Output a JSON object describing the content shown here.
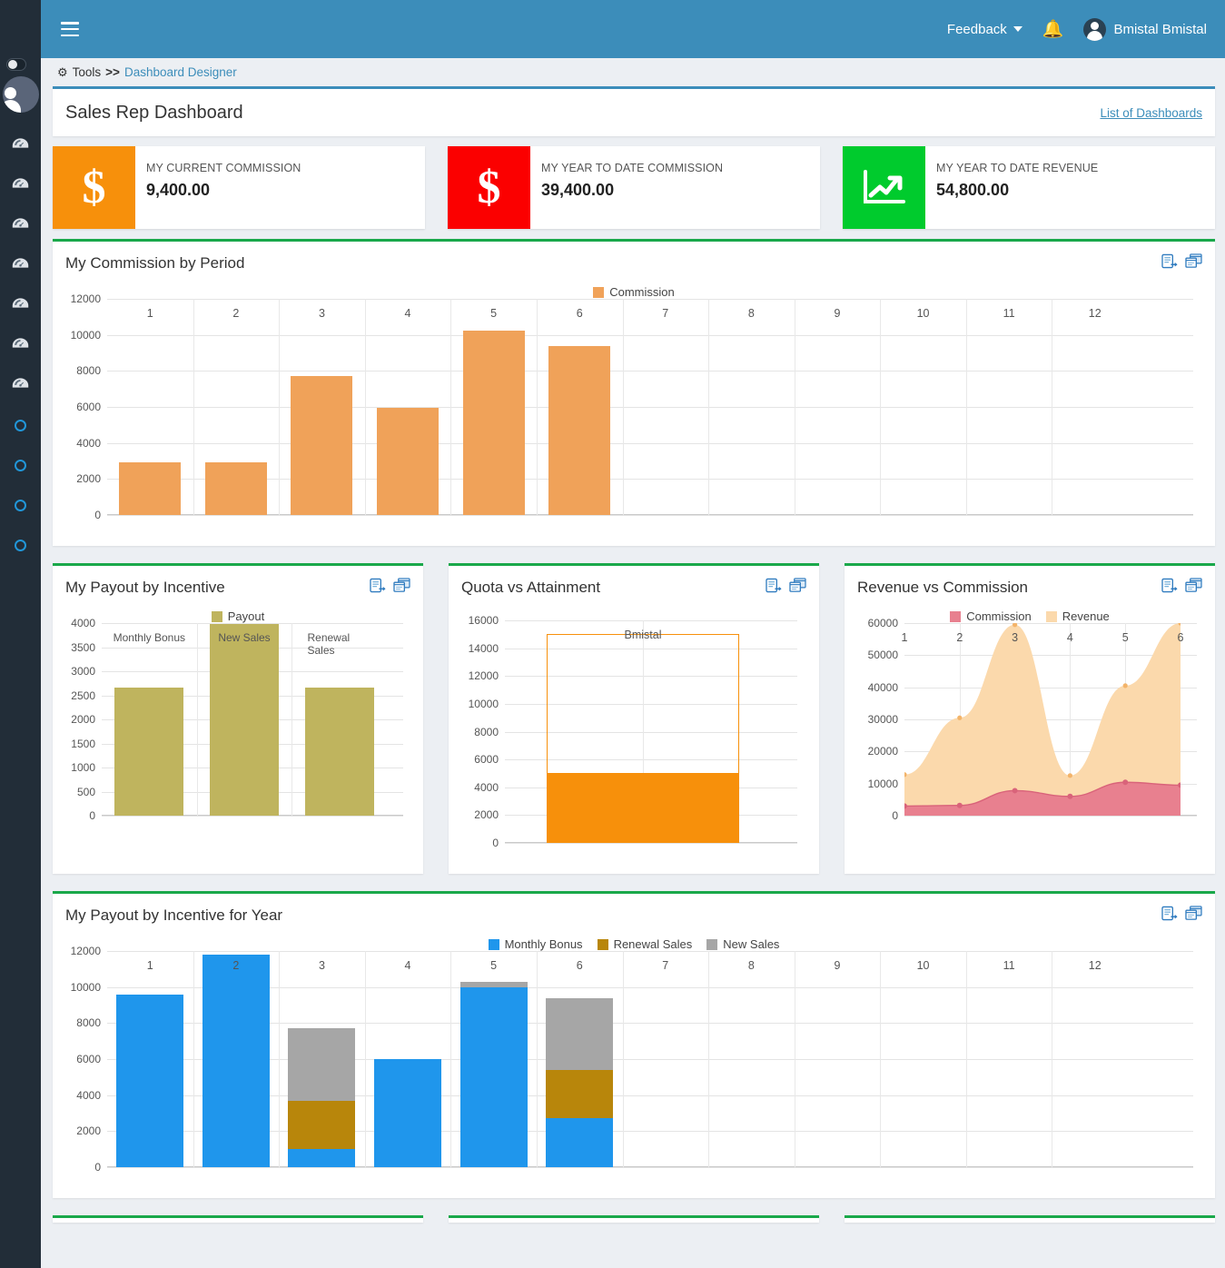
{
  "sidebar": {
    "toggle_name": "sidebar-collapse-toggle",
    "avatar_name": "sidebar-avatar",
    "items": [
      {
        "icon": "gauge-icon"
      },
      {
        "icon": "gauge-icon"
      },
      {
        "icon": "gauge-icon"
      },
      {
        "icon": "gauge-icon"
      },
      {
        "icon": "gauge-icon"
      },
      {
        "icon": "gauge-icon"
      },
      {
        "icon": "gauge-icon"
      },
      {
        "icon": "circle-icon"
      },
      {
        "icon": "circle-icon"
      },
      {
        "icon": "circle-icon"
      },
      {
        "icon": "circle-icon"
      }
    ]
  },
  "topbar": {
    "feedback_label": "Feedback",
    "bell_icon": "bell-icon",
    "user_name": "Bmistal Bmistal",
    "bg_color": "#3c8dba"
  },
  "breadcrumb": {
    "root": "Tools",
    "separator": ">>",
    "current": "Dashboard Designer"
  },
  "page": {
    "title": "Sales Rep Dashboard",
    "list_link": "List of Dashboards",
    "accent_green": "#19a84a",
    "accent_blue": "#3c8dba"
  },
  "kpis": [
    {
      "label": "MY CURRENT COMMISSION",
      "value": "9,400.00",
      "icon": "dollar-icon",
      "color": "#f7900b",
      "glyph": "$"
    },
    {
      "label": "MY YEAR TO DATE COMMISSION",
      "value": "39,400.00",
      "icon": "dollar-icon",
      "color": "#fb0000",
      "glyph": "$"
    },
    {
      "label": "MY YEAR TO DATE REVENUE",
      "value": "54,800.00",
      "icon": "trend-up-icon",
      "color": "#00cb2d",
      "glyph": ""
    }
  ],
  "panel_tools": {
    "export_icon": "export-report-icon",
    "popout_icon": "open-in-window-icon"
  },
  "panels": {
    "commission_by_period": "My Commission by Period",
    "payout_by_incentive": "My Payout by Incentive",
    "quota_vs_attainment": "Quota vs Attainment",
    "revenue_vs_commission": "Revenue vs Commission",
    "payout_by_incentive_year": "My Payout by Incentive for Year"
  },
  "chart_data": [
    {
      "id": "commission-by-period",
      "type": "bar",
      "title": "My Commission by Period",
      "xlabel": "",
      "ylabel": "",
      "categories": [
        "1",
        "2",
        "3",
        "4",
        "5",
        "6",
        "7",
        "8",
        "9",
        "10",
        "11",
        "12"
      ],
      "ylim": [
        0,
        12000
      ],
      "yticks": [
        0,
        2000,
        4000,
        6000,
        8000,
        10000,
        12000
      ],
      "grid": true,
      "legend": {
        "position": "top-center",
        "entries": [
          {
            "name": "Commission",
            "color": "#f0a259"
          }
        ]
      },
      "series": [
        {
          "name": "Commission",
          "color": "#f0a259",
          "values": [
            2950,
            2950,
            7700,
            5950,
            10250,
            9400,
            0,
            0,
            0,
            0,
            0,
            0
          ]
        }
      ]
    },
    {
      "id": "payout-by-incentive",
      "type": "bar",
      "title": "My Payout by Incentive",
      "categories": [
        "Monthly Bonus",
        "New Sales",
        "Renewal Sales"
      ],
      "ylim": [
        0,
        4000
      ],
      "yticks": [
        0,
        500,
        1000,
        1500,
        2000,
        2500,
        3000,
        3500,
        4000
      ],
      "grid": true,
      "legend": {
        "position": "top-center",
        "entries": [
          {
            "name": "Payout",
            "color": "#bfb45e"
          }
        ]
      },
      "series": [
        {
          "name": "Payout",
          "color": "#bfb45e",
          "values": [
            2670,
            3990,
            2670
          ]
        }
      ]
    },
    {
      "id": "quota-vs-attainment",
      "type": "bar",
      "title": "Quota vs Attainment",
      "categories": [
        "Bmistal"
      ],
      "ylim": [
        0,
        16000
      ],
      "yticks": [
        0,
        2000,
        4000,
        6000,
        8000,
        10000,
        12000,
        14000,
        16000
      ],
      "grid": true,
      "legend": {
        "position": "none",
        "entries": []
      },
      "series": [
        {
          "name": "Quota",
          "color": "#f7900b",
          "style": "outline",
          "values": [
            15000
          ]
        },
        {
          "name": "Attainment",
          "color": "#f7900b",
          "style": "filled",
          "values": [
            5000
          ]
        }
      ]
    },
    {
      "id": "revenue-vs-commission",
      "type": "area",
      "title": "Revenue vs Commission",
      "x": [
        "1",
        "2",
        "3",
        "4",
        "5",
        "6"
      ],
      "ylim": [
        0,
        60000
      ],
      "yticks": [
        0,
        10000,
        20000,
        30000,
        40000,
        50000,
        60000
      ],
      "grid": true,
      "legend": {
        "position": "top-center",
        "entries": [
          {
            "name": "Commission",
            "color": "#e8808f"
          },
          {
            "name": "Revenue",
            "color": "#fbd9ac"
          }
        ]
      },
      "series": [
        {
          "name": "Revenue",
          "color": "#fbd9ac",
          "values": [
            12800,
            30500,
            59500,
            12500,
            40500,
            60000
          ]
        },
        {
          "name": "Commission",
          "color": "#e8808f",
          "values": [
            3000,
            3200,
            7800,
            6000,
            10400,
            9500
          ]
        }
      ]
    },
    {
      "id": "payout-by-incentive-for-year",
      "type": "bar",
      "stacked": true,
      "title": "My Payout by Incentive for Year",
      "categories": [
        "1",
        "2",
        "3",
        "4",
        "5",
        "6",
        "7",
        "8",
        "9",
        "10",
        "11",
        "12"
      ],
      "ylim": [
        0,
        12000
      ],
      "yticks": [
        0,
        2000,
        4000,
        6000,
        8000,
        10000,
        12000
      ],
      "grid": true,
      "legend": {
        "position": "top-center",
        "entries": [
          {
            "name": "Monthly Bonus",
            "color": "#1f96ec"
          },
          {
            "name": "Renewal Sales",
            "color": "#b8860b"
          },
          {
            "name": "New Sales",
            "color": "#a6a6a6"
          }
        ]
      },
      "series": [
        {
          "name": "Monthly Bonus",
          "color": "#1f96ec",
          "values": [
            9600,
            11800,
            1000,
            6000,
            10000,
            2700,
            0,
            0,
            0,
            0,
            0,
            0
          ]
        },
        {
          "name": "Renewal Sales",
          "color": "#b8860b",
          "values": [
            0,
            0,
            2700,
            0,
            0,
            2700,
            0,
            0,
            0,
            0,
            0,
            0
          ]
        },
        {
          "name": "New Sales",
          "color": "#a6a6a6",
          "values": [
            0,
            0,
            4000,
            0,
            300,
            4000,
            0,
            0,
            0,
            0,
            0,
            0
          ]
        }
      ]
    }
  ]
}
